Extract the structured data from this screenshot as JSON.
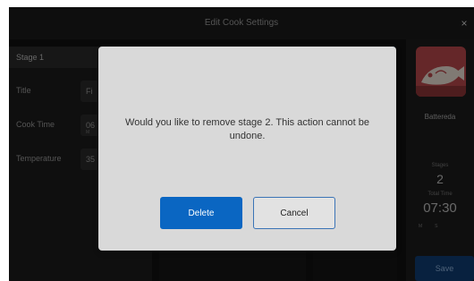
{
  "window": {
    "title": "Edit Cook Settings",
    "close_glyph": "×"
  },
  "stage": {
    "header": "Stage 1",
    "title_label": "Title",
    "title_value": "Fi",
    "cook_time_label": "Cook Time",
    "cook_time_value": "06",
    "cook_time_unit": "M",
    "temperature_label": "Temperature",
    "temperature_value": "35"
  },
  "sidebar": {
    "recipe_name": "Battereda",
    "stages_label": "Stages",
    "stages_value": "2",
    "total_time_label": "Total Time",
    "total_time_value": "07:30",
    "unit_m": "M",
    "unit_s": "S",
    "save_label": "Save",
    "thumb_icon": "fish-icon"
  },
  "dialog": {
    "message": "Would you like to remove stage 2. This action cannot be undone.",
    "delete_label": "Delete",
    "cancel_label": "Cancel"
  },
  "colors": {
    "accent": "#0a66c2",
    "recipe_thumb": "#b8484b"
  }
}
